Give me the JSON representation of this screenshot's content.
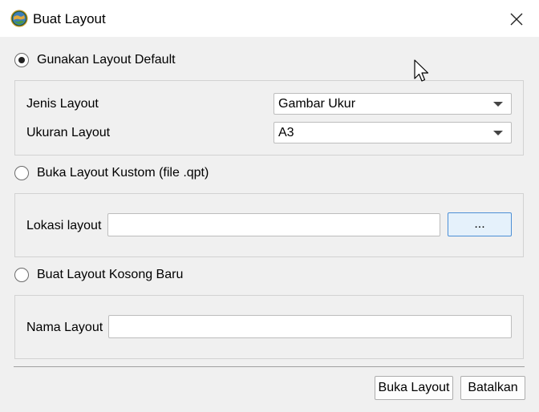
{
  "window": {
    "title": "Buat Layout",
    "close_icon": "close-icon",
    "app_icon": "globe-icon"
  },
  "option_default": {
    "label": "Gunakan Layout Default",
    "checked": true,
    "jenis_label": "Jenis Layout",
    "jenis_value": "Gambar Ukur",
    "ukuran_label": "Ukuran Layout",
    "ukuran_value": "A3"
  },
  "option_custom": {
    "label": "Buka Layout Kustom (file .qpt)",
    "checked": false,
    "lokasi_label": "Lokasi layout",
    "lokasi_value": "",
    "browse_label": "..."
  },
  "option_blank": {
    "label": "Buat Layout Kosong Baru",
    "checked": false,
    "nama_label": "Nama Layout",
    "nama_value": ""
  },
  "buttons": {
    "open_label": "Buka Layout",
    "cancel_label": "Batalkan"
  },
  "colors": {
    "accent_border": "#4c8fd6",
    "accent_fill": "#e5f1fb"
  }
}
